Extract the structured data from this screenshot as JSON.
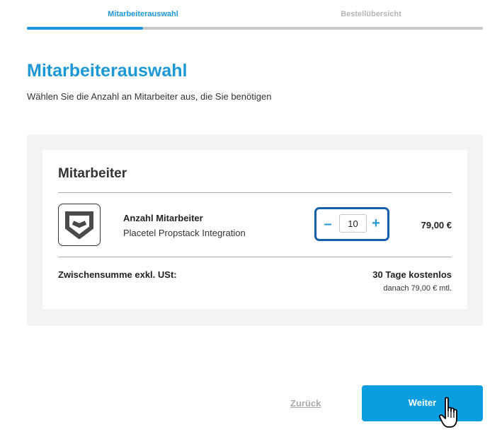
{
  "steps": [
    {
      "label": "Mitarbeiterauswahl",
      "active": true
    },
    {
      "label": "Bestellübersicht",
      "active": false
    }
  ],
  "progress": 0.255,
  "page": {
    "title": "Mitarbeiterauswahl",
    "subtitle": "Wählen Sie die Anzahl an Mitarbeiter aus, die Sie benötigen"
  },
  "card": {
    "title": "Mitarbeiter",
    "item": {
      "name": "Anzahl Mitarbeiter",
      "description": "Placetel Propstack Integration",
      "logo_icon": "shield-icon",
      "quantity": "10",
      "price": "79,00 €"
    },
    "summary": {
      "label": "Zwischensumme exkl. USt:",
      "value": "30 Tage kostenlos",
      "note": "danach 79,00 € mtl."
    }
  },
  "stepper": {
    "minus": "–",
    "plus": "+"
  },
  "actions": {
    "back": "Zurück",
    "next": "Weiter"
  },
  "colors": {
    "accent": "#1b98d5",
    "button": "#0a9ee0",
    "stepper_border": "#1560a8"
  }
}
